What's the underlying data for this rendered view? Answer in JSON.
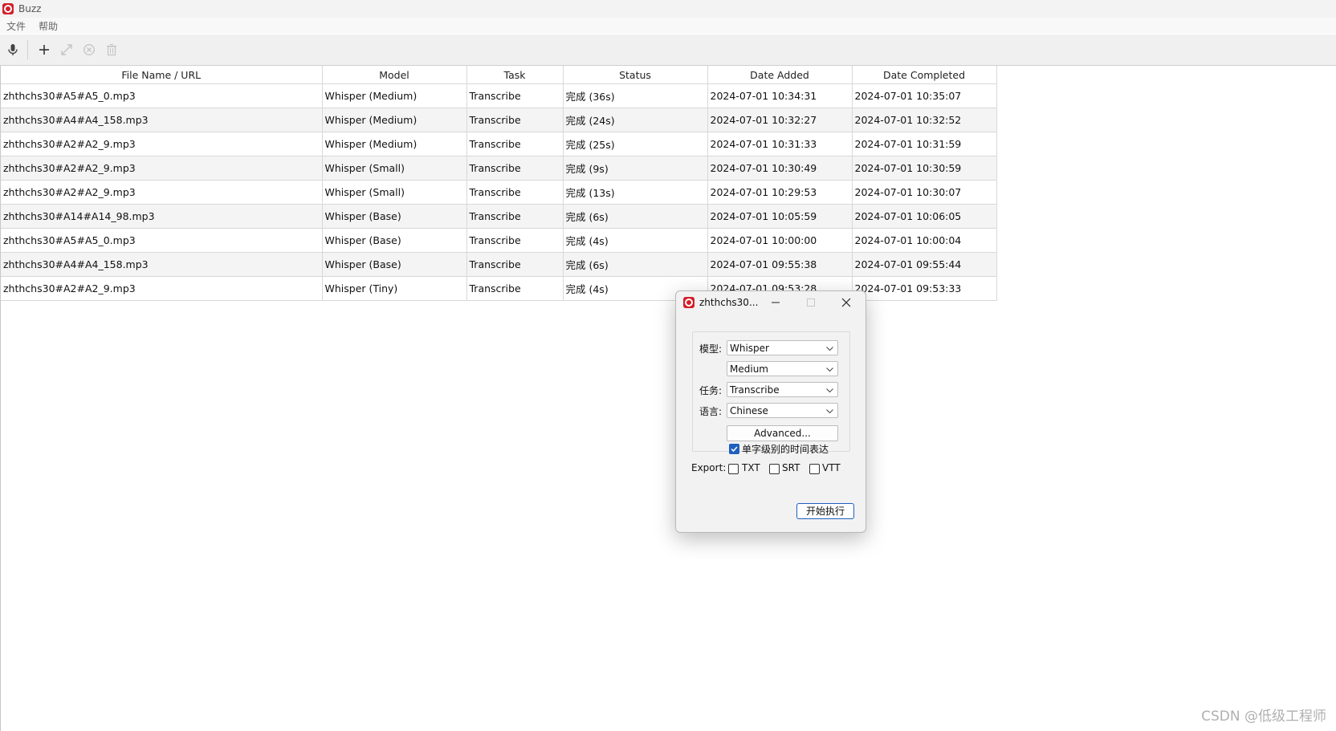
{
  "app": {
    "title": "Buzz",
    "brand_color": "#d21f2a"
  },
  "menu": [
    "文件",
    "帮助"
  ],
  "toolbar": {
    "icons": [
      "microphone-icon",
      "plus-icon",
      "expand-icon",
      "cancel-icon",
      "trash-icon"
    ]
  },
  "table": {
    "columns": [
      "File Name / URL",
      "Model",
      "Task",
      "Status",
      "Date Added",
      "Date Completed"
    ],
    "rows": [
      [
        "zhthchs30#A5#A5_0.mp3",
        "Whisper (Medium)",
        "Transcribe",
        "完成 (36s)",
        "2024-07-01 10:34:31",
        "2024-07-01 10:35:07"
      ],
      [
        "zhthchs30#A4#A4_158.mp3",
        "Whisper (Medium)",
        "Transcribe",
        "完成 (24s)",
        "2024-07-01 10:32:27",
        "2024-07-01 10:32:52"
      ],
      [
        "zhthchs30#A2#A2_9.mp3",
        "Whisper (Medium)",
        "Transcribe",
        "完成 (25s)",
        "2024-07-01 10:31:33",
        "2024-07-01 10:31:59"
      ],
      [
        "zhthchs30#A2#A2_9.mp3",
        "Whisper (Small)",
        "Transcribe",
        "完成 (9s)",
        "2024-07-01 10:30:49",
        "2024-07-01 10:30:59"
      ],
      [
        "zhthchs30#A2#A2_9.mp3",
        "Whisper (Small)",
        "Transcribe",
        "完成 (13s)",
        "2024-07-01 10:29:53",
        "2024-07-01 10:30:07"
      ],
      [
        "zhthchs30#A14#A14_98.mp3",
        "Whisper (Base)",
        "Transcribe",
        "完成 (6s)",
        "2024-07-01 10:05:59",
        "2024-07-01 10:06:05"
      ],
      [
        "zhthchs30#A5#A5_0.mp3",
        "Whisper (Base)",
        "Transcribe",
        "完成 (4s)",
        "2024-07-01 10:00:00",
        "2024-07-01 10:00:04"
      ],
      [
        "zhthchs30#A4#A4_158.mp3",
        "Whisper (Base)",
        "Transcribe",
        "完成 (6s)",
        "2024-07-01 09:55:38",
        "2024-07-01 09:55:44"
      ],
      [
        "zhthchs30#A2#A2_9.mp3",
        "Whisper (Tiny)",
        "Transcribe",
        "完成 (4s)",
        "2024-07-01 09:53:28",
        "2024-07-01 09:53:33"
      ]
    ]
  },
  "dialog": {
    "title": "zhthchs30...",
    "model_label": "模型:",
    "model_value": "Whisper",
    "size_value": "Medium",
    "task_label": "任务:",
    "task_value": "Transcribe",
    "language_label": "语言:",
    "language_value": "Chinese",
    "advanced_label": "Advanced...",
    "word_timestamps_label": "单字级别的时间表达",
    "word_timestamps_checked": true,
    "export_label": "Export:",
    "export_txt": "TXT",
    "export_srt": "SRT",
    "export_vtt": "VTT",
    "run_label": "开始执行"
  },
  "watermark": "CSDN @低级工程师"
}
